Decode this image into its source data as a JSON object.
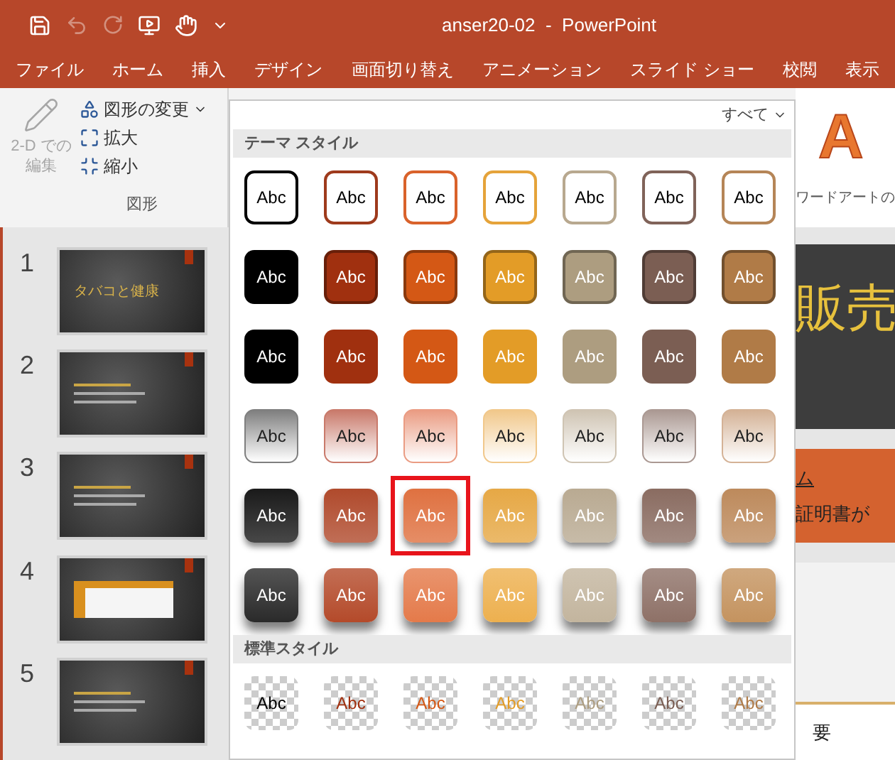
{
  "window": {
    "title": "anser20-02  -  PowerPoint"
  },
  "menu_tabs": [
    {
      "label": "ファイル",
      "selected": false
    },
    {
      "label": "ホーム",
      "selected": false
    },
    {
      "label": "挿入",
      "selected": false
    },
    {
      "label": "デザイン",
      "selected": false
    },
    {
      "label": "画面切り替え",
      "selected": false
    },
    {
      "label": "アニメーション",
      "selected": false
    },
    {
      "label": "スライド ショー",
      "selected": false
    },
    {
      "label": "校閲",
      "selected": false
    },
    {
      "label": "表示",
      "selected": false
    }
  ],
  "ribbon_group": {
    "edit_2d": {
      "label_lines": [
        "2-D での",
        "編集"
      ],
      "disabled": true
    },
    "change_shape": "図形の変更",
    "enlarge": "拡大",
    "shrink": "縮小",
    "label": "図形"
  },
  "slides": [
    {
      "number": "1",
      "title": "タバコと健康"
    },
    {
      "number": "2"
    },
    {
      "number": "3"
    },
    {
      "number": "4"
    },
    {
      "number": "5"
    }
  ],
  "gallery": {
    "filter": "すべて",
    "sections": [
      {
        "title": "テーマ スタイル",
        "rows": [
          {
            "kind": "outline",
            "items": [
              {
                "label": "Abc",
                "color": "#000000",
                "selected": false
              },
              {
                "label": "Abc",
                "color": "#9e3a1c",
                "selected": false
              },
              {
                "label": "Abc",
                "color": "#d9622b",
                "selected": false
              },
              {
                "label": "Abc",
                "color": "#e5a33a",
                "selected": false
              },
              {
                "label": "Abc",
                "color": "#b8a88f",
                "selected": false
              },
              {
                "label": "Abc",
                "color": "#806359",
                "selected": false
              },
              {
                "label": "Abc",
                "color": "#b58557",
                "selected": false
              }
            ]
          },
          {
            "kind": "fill_bordered",
            "items": [
              {
                "label": "Abc",
                "color": "#000000",
                "selected": false
              },
              {
                "label": "Abc",
                "color": "#a0300f",
                "selected": false
              },
              {
                "label": "Abc",
                "color": "#d45815",
                "selected": false
              },
              {
                "label": "Abc",
                "color": "#e39c27",
                "selected": false
              },
              {
                "label": "Abc",
                "color": "#ad9d80",
                "selected": false
              },
              {
                "label": "Abc",
                "color": "#7b5e53",
                "selected": false
              },
              {
                "label": "Abc",
                "color": "#b07b47",
                "selected": false
              }
            ]
          },
          {
            "kind": "fill",
            "items": [
              {
                "label": "Abc",
                "color": "#000000",
                "selected": false
              },
              {
                "label": "Abc",
                "color": "#a0300f",
                "selected": false
              },
              {
                "label": "Abc",
                "color": "#d45815",
                "selected": false
              },
              {
                "label": "Abc",
                "color": "#e39c27",
                "selected": false
              },
              {
                "label": "Abc",
                "color": "#ad9d80",
                "selected": false
              },
              {
                "label": "Abc",
                "color": "#7b5e53",
                "selected": false
              },
              {
                "label": "Abc",
                "color": "#b07b47",
                "selected": false
              }
            ]
          },
          {
            "kind": "light_gradient",
            "items": [
              {
                "label": "Abc",
                "color": "#7f7f7f",
                "selected": false
              },
              {
                "label": "Abc",
                "color": "#c97a6b",
                "selected": false
              },
              {
                "label": "Abc",
                "color": "#ea9c83",
                "selected": false
              },
              {
                "label": "Abc",
                "color": "#f1c88b",
                "selected": false
              },
              {
                "label": "Abc",
                "color": "#cfc4b3",
                "selected": false
              },
              {
                "label": "Abc",
                "color": "#ab9993",
                "selected": false
              },
              {
                "label": "Abc",
                "color": "#d4b296",
                "selected": false
              }
            ]
          },
          {
            "kind": "intense",
            "items": [
              {
                "label": "Abc",
                "color": "#1a1a1a",
                "selected": false
              },
              {
                "label": "Abc",
                "color": "#b04a2c",
                "selected": false
              },
              {
                "label": "Abc",
                "color": "#df7140",
                "selected": true
              },
              {
                "label": "Abc",
                "color": "#e6a845",
                "selected": false
              },
              {
                "label": "Abc",
                "color": "#b9aa92",
                "selected": false
              },
              {
                "label": "Abc",
                "color": "#8a6c61",
                "selected": false
              },
              {
                "label": "Abc",
                "color": "#bd8a5c",
                "selected": false
              }
            ]
          },
          {
            "kind": "shadow",
            "items": [
              {
                "label": "Abc",
                "color": "#2a2a2a",
                "selected": false
              },
              {
                "label": "Abc",
                "color": "#b44a2a",
                "selected": false
              },
              {
                "label": "Abc",
                "color": "#e47a4a",
                "selected": false
              },
              {
                "label": "Abc",
                "color": "#edb04f",
                "selected": false
              },
              {
                "label": "Abc",
                "color": "#c3b59e",
                "selected": false
              },
              {
                "label": "Abc",
                "color": "#8e7167",
                "selected": false
              },
              {
                "label": "Abc",
                "color": "#c4935f",
                "selected": false
              }
            ]
          }
        ]
      },
      {
        "title": "標準スタイル",
        "rows": [
          {
            "kind": "transparent",
            "items": [
              {
                "label": "Abc",
                "color": "#000000",
                "selected": false
              },
              {
                "label": "Abc",
                "color": "#a0300f",
                "selected": false
              },
              {
                "label": "Abc",
                "color": "#d45815",
                "selected": false
              },
              {
                "label": "Abc",
                "color": "#e39c27",
                "selected": false
              },
              {
                "label": "Abc",
                "color": "#ad9d80",
                "selected": false
              },
              {
                "label": "Abc",
                "color": "#7b5e53",
                "selected": false
              },
              {
                "label": "Abc",
                "color": "#b07b47",
                "selected": false
              }
            ]
          }
        ]
      }
    ]
  },
  "wordart": {
    "sample": "A",
    "label": "ワードアートの"
  },
  "slide_content": {
    "title": "販売",
    "band_line_1": "ム",
    "band_line_2": "証明書が",
    "footer": "要"
  }
}
